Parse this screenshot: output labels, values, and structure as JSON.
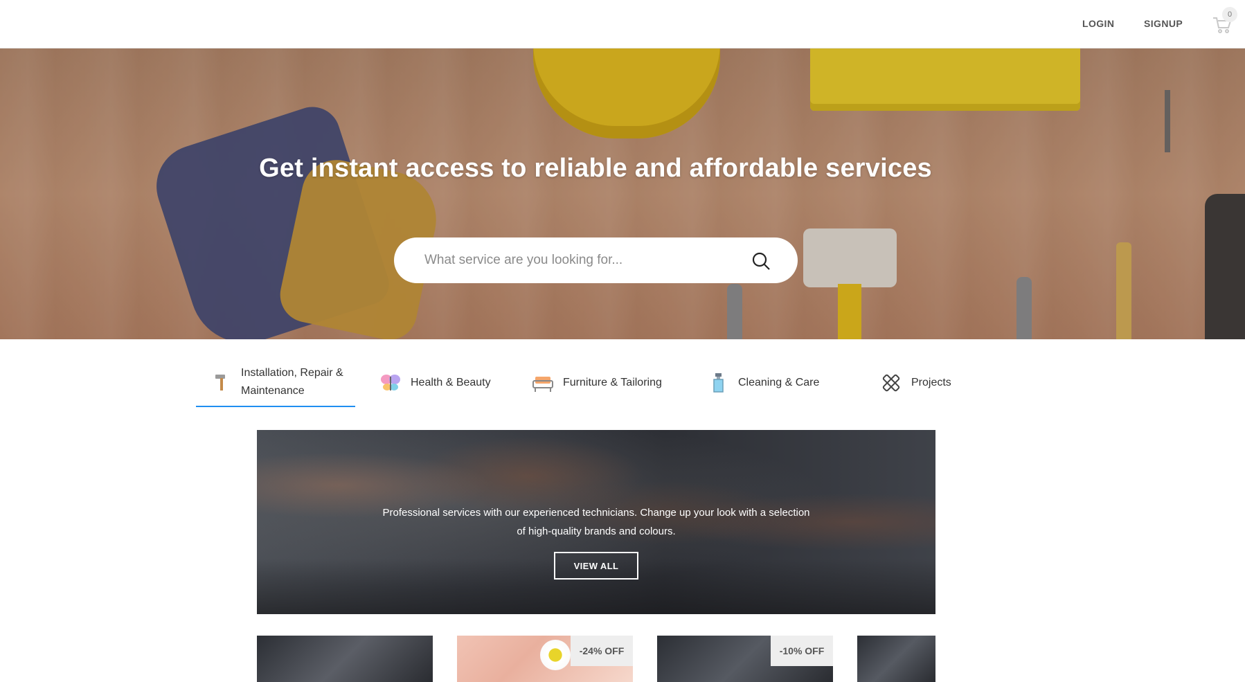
{
  "header": {
    "login_label": "LOGIN",
    "signup_label": "SIGNUP",
    "cart_count": "0",
    "cart_icon": "shopping-cart-icon"
  },
  "hero": {
    "title": "Get instant access to reliable and affordable services",
    "search": {
      "placeholder": "What service are you looking for...",
      "value": "",
      "icon": "search-icon"
    }
  },
  "categories": [
    {
      "label": "Installation, Repair & Maintenance",
      "icon": "hammer-icon",
      "active": true
    },
    {
      "label": "Health & Beauty",
      "icon": "butterfly-icon",
      "active": false
    },
    {
      "label": "Furniture & Tailoring",
      "icon": "sofa-icon",
      "active": false
    },
    {
      "label": "Cleaning & Care",
      "icon": "spray-bottle-icon",
      "active": false
    },
    {
      "label": "Projects",
      "icon": "tools-crossed-icon",
      "active": false
    }
  ],
  "banner": {
    "text": "Professional services with our experienced technicians. Change up your look with a selection of high-quality brands and colours.",
    "button_label": "VIEW ALL"
  },
  "cards": [
    {
      "discount": ""
    },
    {
      "discount": "-24% OFF"
    },
    {
      "discount": "-10% OFF"
    },
    {
      "discount": ""
    }
  ],
  "colors": {
    "accent": "#1f8ef1",
    "text_dark": "#333333",
    "badge_bg": "#eeeeee"
  }
}
